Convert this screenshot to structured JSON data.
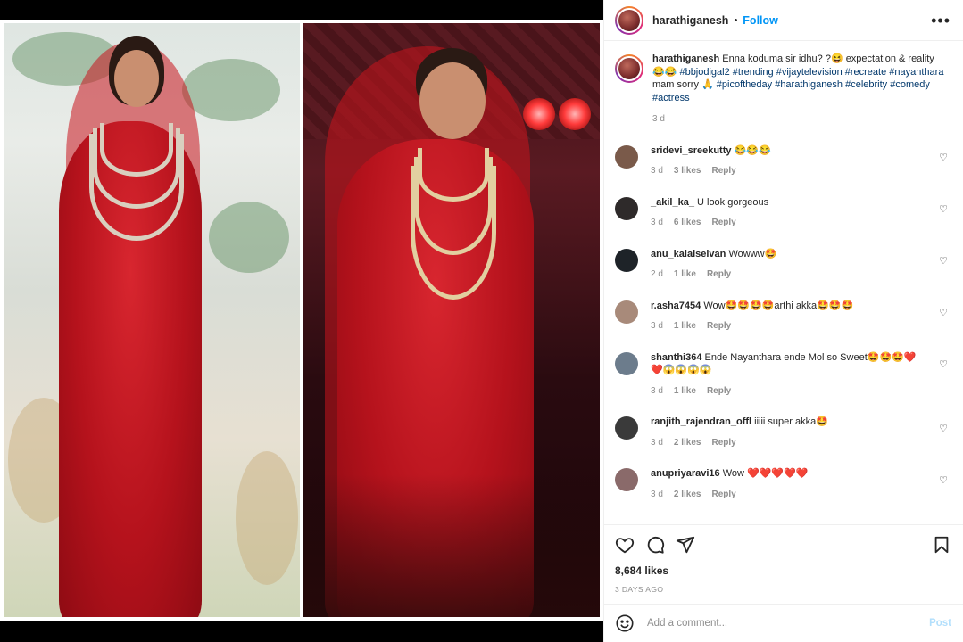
{
  "post": {
    "username": "harathiganesh",
    "separator": "•",
    "follow_label": "Follow",
    "more_label": "•••"
  },
  "caption": {
    "username": "harathiganesh",
    "text_1": "Enna koduma sir idhu? ?😆 expectation & reality 😂😂 ",
    "tags_1": "#bbjodigal2 #trending #vijaytelevision #recreate #nayanthara",
    "text_2": " mam sorry 🙏 ",
    "tags_2": "#picoftheday #harathiganesh #celebrity #comedy #actress",
    "time": "3 d"
  },
  "comments": [
    {
      "username": "sridevi_sreekutty",
      "text": "😂😂😂",
      "time": "3 d",
      "likes": "3 likes",
      "reply": "Reply",
      "avatar_color": "#7a5a4a"
    },
    {
      "username": "_akil_ka_",
      "text": "U look gorgeous",
      "time": "3 d",
      "likes": "6 likes",
      "reply": "Reply",
      "avatar_color": "#2e2a2a"
    },
    {
      "username": "anu_kalaiselvan",
      "text": "Wowww🤩",
      "time": "2 d",
      "likes": "1 like",
      "reply": "Reply",
      "avatar_color": "#1e2328"
    },
    {
      "username": "r.asha7454",
      "text": "Wow🤩🤩🤩🤩arthi akka🤩🤩🤩",
      "time": "3 d",
      "likes": "1 like",
      "reply": "Reply",
      "avatar_color": "#a88a7a"
    },
    {
      "username": "shanthi364",
      "text": "Ende Nayanthara ende Mol so Sweet🤩🤩🤩❤️❤️😱😱😱😱",
      "time": "3 d",
      "likes": "1 like",
      "reply": "Reply",
      "avatar_color": "#6c7c8c"
    },
    {
      "username": "ranjith_rajendran_offl",
      "text": "iiiii super akka🤩",
      "time": "3 d",
      "likes": "2 likes",
      "reply": "Reply",
      "avatar_color": "#3a3a3a"
    },
    {
      "username": "anupriyaravi16",
      "text": "Wow ❤️❤️❤️❤️❤️",
      "time": "3 d",
      "likes": "2 likes",
      "reply": "Reply",
      "avatar_color": "#8a6a6a"
    }
  ],
  "actions": {
    "likes": "8,684 likes",
    "date": "3 DAYS AGO"
  },
  "add_comment": {
    "placeholder": "Add a comment...",
    "post_label": "Post"
  },
  "colors": {
    "link": "#0095f6",
    "hashtag": "#00376b",
    "muted": "#8e8e8e",
    "dress_red": "#b5121c"
  }
}
